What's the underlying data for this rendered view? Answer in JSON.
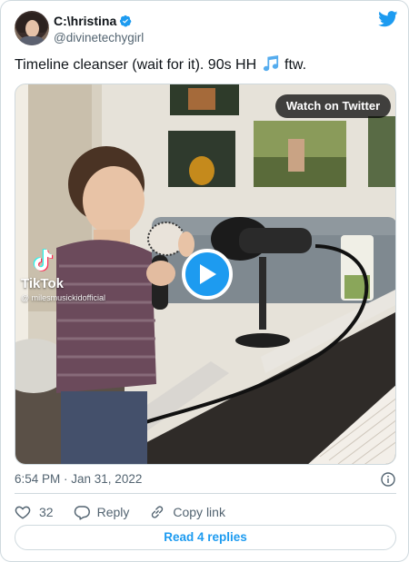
{
  "author": {
    "display_name": "C:\\hristina",
    "handle": "@divinetechygirl",
    "verified": true
  },
  "tweet": {
    "text_before_emoji": "Timeline cleanser (wait for it). 90s HH ",
    "emoji_name": "musical-notes",
    "text_after_emoji": " ftw."
  },
  "media": {
    "watch_label": "Watch on Twitter",
    "watermark_brand": "TikTok",
    "watermark_handle": "@ milesmusickidofficial"
  },
  "meta": {
    "timestamp": "6:54 PM · Jan 31, 2022"
  },
  "actions": {
    "like_count": "32",
    "reply_label": "Reply",
    "copy_link_label": "Copy link"
  },
  "footer": {
    "read_replies_label": "Read 4 replies"
  },
  "colors": {
    "brand_blue": "#1d9bf0",
    "secondary_text": "#536471",
    "border": "#cfd9de"
  },
  "icons": [
    "verified-badge-icon",
    "twitter-bird-icon",
    "play-icon",
    "tiktok-icon",
    "info-icon",
    "heart-icon",
    "reply-icon",
    "link-icon"
  ]
}
